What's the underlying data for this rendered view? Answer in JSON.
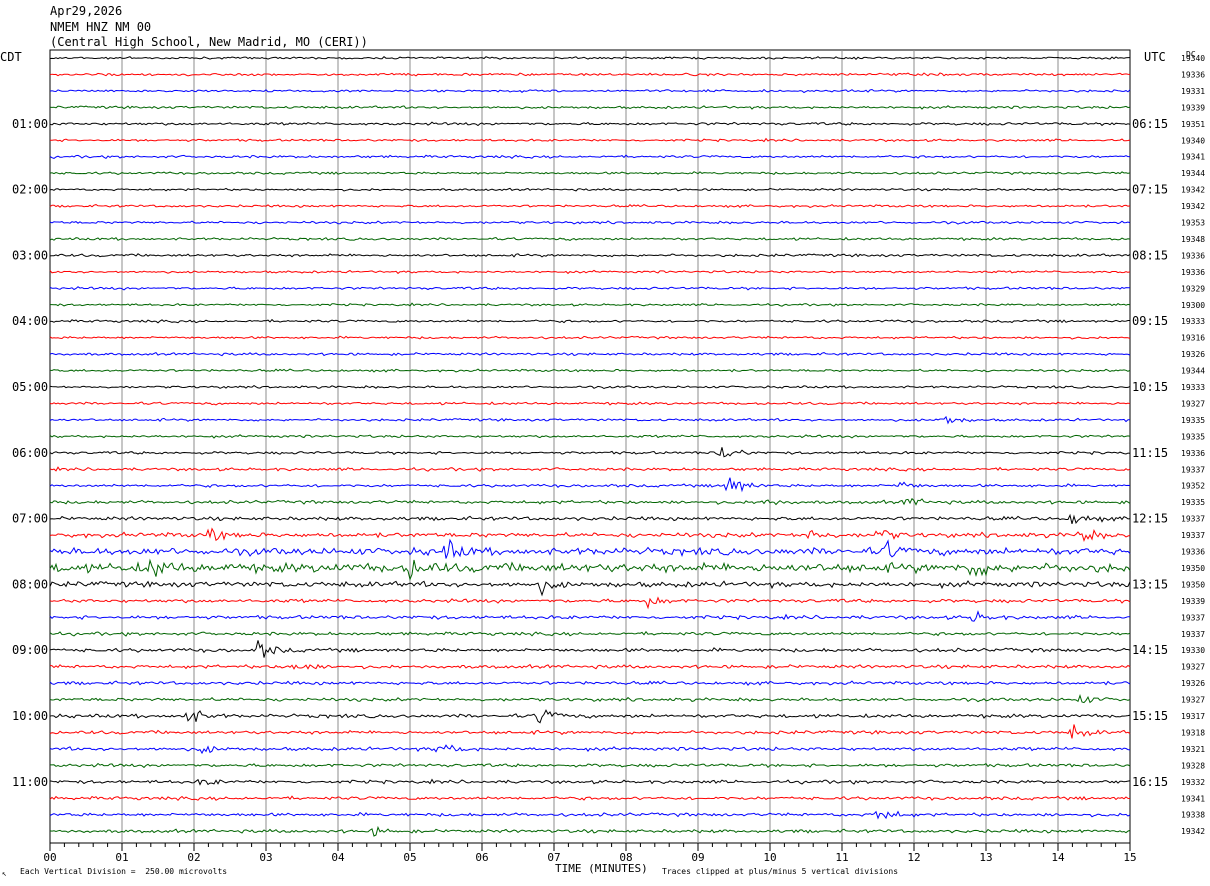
{
  "header": {
    "date": "Apr29,2026",
    "station": "NMEM HNZ NM 00",
    "location": "(Central High School, New Madrid, MO (CERI))"
  },
  "left_timezone": "CDT",
  "right_timezone": "UTC",
  "right_column_title": "DC",
  "footer": {
    "scale_note": "Each Vertical Division =  250.00 microvolts",
    "xlabel": "TIME (MINUTES)",
    "clip_note": "Traces clipped at plus/minus 5 vertical divisions",
    "corner_mark": "↖"
  },
  "colors": {
    "trace_cycle": [
      "#000000",
      "#ff0000",
      "#0000ff",
      "#006400"
    ],
    "grid": "#8c8c8c",
    "frame": "#000000"
  },
  "chart_data": {
    "type": "line",
    "title": "NMEM HNZ NM 00",
    "xlabel": "TIME (MINUTES)",
    "xlim": [
      0,
      15
    ],
    "x_ticks": [
      "00",
      "01",
      "02",
      "03",
      "04",
      "05",
      "06",
      "07",
      "08",
      "09",
      "10",
      "11",
      "12",
      "13",
      "14",
      "15"
    ],
    "minutes_per_line": 15,
    "left_hour_labels": [
      "01:00",
      "02:00",
      "03:00",
      "04:00",
      "05:00",
      "06:00",
      "07:00",
      "08:00",
      "09:00",
      "10:00",
      "11:00"
    ],
    "right_hour_labels": [
      "06:15",
      "07:15",
      "08:15",
      "09:15",
      "10:15",
      "11:15",
      "12:15",
      "13:15",
      "14:15",
      "15:15",
      "16:15"
    ],
    "trace_dc_offsets": [
      19340,
      19336,
      19331,
      19339,
      19351,
      19340,
      19341,
      19344,
      19342,
      19342,
      19353,
      19348,
      19336,
      19336,
      19329,
      19300,
      19333,
      19316,
      19326,
      19344,
      19333,
      19327,
      19335,
      19335,
      19336,
      19337,
      19352,
      19335,
      19337,
      19337,
      19336,
      19350,
      19350,
      19339,
      19337,
      19337,
      19330,
      19327,
      19326,
      19327,
      19317,
      19318,
      19321,
      19328,
      19332,
      19341,
      19338,
      19342
    ],
    "noise_level": [
      1.2,
      1.4,
      1.3,
      1.4,
      1.5,
      1.3,
      1.4,
      1.3,
      1.2,
      1.3,
      1.4,
      1.4,
      1.5,
      1.3,
      1.4,
      1.2,
      1.4,
      1.3,
      1.4,
      1.3,
      1.3,
      1.4,
      1.4,
      1.4,
      1.5,
      1.6,
      1.6,
      1.8,
      2.0,
      2.5,
      4.0,
      5.0,
      3.0,
      2.0,
      2.0,
      1.8,
      2.0,
      1.9,
      1.8,
      1.8,
      2.0,
      1.9,
      1.9,
      1.8,
      1.8,
      1.8,
      1.8,
      1.8
    ],
    "events": [
      {
        "trace": 22,
        "minute": 12.4,
        "amp": 8
      },
      {
        "trace": 24,
        "minute": 9.3,
        "amp": 14
      },
      {
        "trace": 26,
        "minute": 9.4,
        "amp": 22
      },
      {
        "trace": 26,
        "minute": 11.8,
        "amp": 6
      },
      {
        "trace": 27,
        "minute": 11.9,
        "amp": 7
      },
      {
        "trace": 27,
        "minute": 9.9,
        "amp": 6
      },
      {
        "trace": 28,
        "minute": 14.2,
        "amp": 10
      },
      {
        "trace": 29,
        "minute": 2.2,
        "amp": 9
      },
      {
        "trace": 29,
        "minute": 10.5,
        "amp": 10
      },
      {
        "trace": 29,
        "minute": 11.5,
        "amp": 9
      },
      {
        "trace": 29,
        "minute": 14.3,
        "amp": 10
      },
      {
        "trace": 30,
        "minute": 5.5,
        "amp": 12
      },
      {
        "trace": 30,
        "minute": 11.6,
        "amp": 10
      },
      {
        "trace": 31,
        "minute": 1.4,
        "amp": 12
      },
      {
        "trace": 31,
        "minute": 5.0,
        "amp": 12
      },
      {
        "trace": 31,
        "minute": 12.8,
        "amp": 12
      },
      {
        "trace": 32,
        "minute": 6.8,
        "amp": 9
      },
      {
        "trace": 33,
        "minute": 8.3,
        "amp": 8
      },
      {
        "trace": 34,
        "minute": 12.8,
        "amp": 8
      },
      {
        "trace": 36,
        "minute": 2.9,
        "amp": 12
      },
      {
        "trace": 37,
        "minute": 3.4,
        "amp": 8
      },
      {
        "trace": 39,
        "minute": 14.3,
        "amp": 6
      },
      {
        "trace": 40,
        "minute": 1.9,
        "amp": 14
      },
      {
        "trace": 40,
        "minute": 6.8,
        "amp": 13
      },
      {
        "trace": 41,
        "minute": 14.2,
        "amp": 9
      },
      {
        "trace": 42,
        "minute": 5.4,
        "amp": 11
      },
      {
        "trace": 42,
        "minute": 2.1,
        "amp": 6
      },
      {
        "trace": 44,
        "minute": 2.1,
        "amp": 5
      },
      {
        "trace": 46,
        "minute": 11.5,
        "amp": 13
      },
      {
        "trace": 47,
        "minute": 4.5,
        "amp": 5
      }
    ],
    "grid": true
  }
}
